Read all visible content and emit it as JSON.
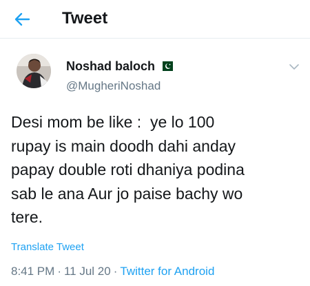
{
  "header": {
    "title": "Tweet",
    "back_icon": "arrow-left-icon",
    "accent": "#1da1f2"
  },
  "tweet": {
    "author_name": "Noshad baloch",
    "flag_icon": "pakistan-flag-icon",
    "handle": "@MugheriNoshad",
    "text": "Desi mom be like :  ye lo 100\nrupay is main doodh dahi anday\npapay double roti dhaniya podina\nsab le ana Aur jo paise bachy wo\ntere.",
    "translate_label": "Translate Tweet",
    "time": "8:41 PM",
    "date": "11 Jul 20",
    "source": "Twitter for Android",
    "separator": "·"
  }
}
